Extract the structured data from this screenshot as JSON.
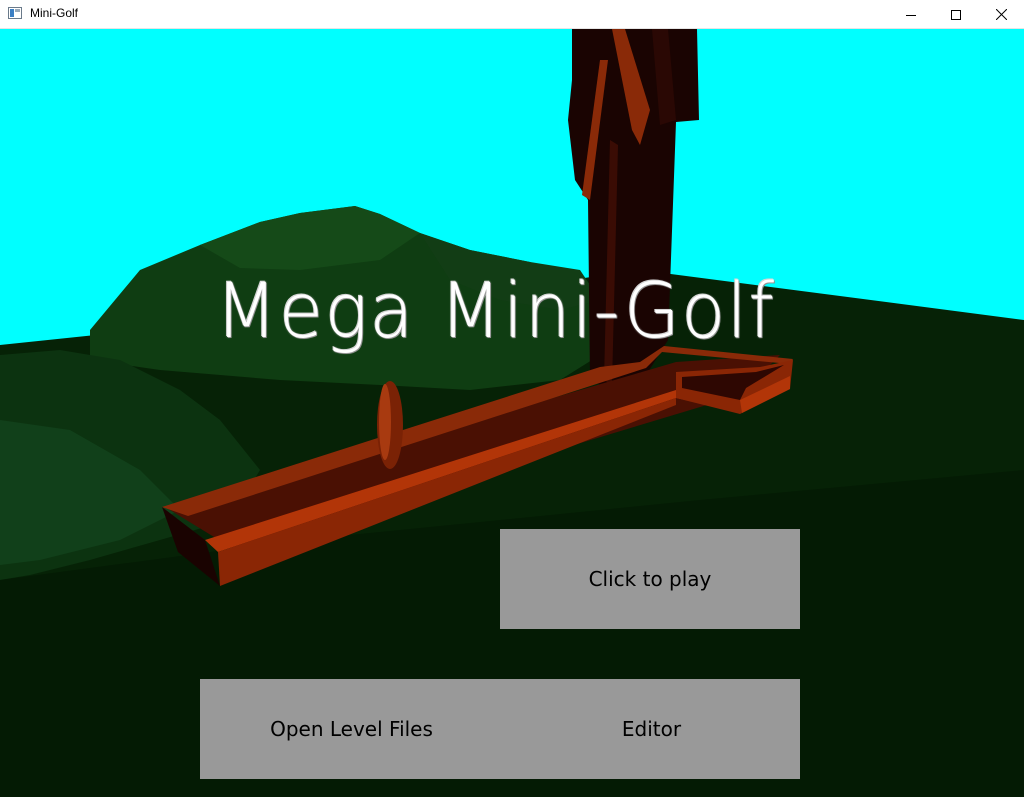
{
  "window": {
    "title": "Mini-Golf",
    "icon": "app-window-icon",
    "controls": [
      "minimize-icon",
      "maximize-icon",
      "close-icon"
    ]
  },
  "game": {
    "title": "Mega Mini-Golf"
  },
  "menu": {
    "play_label": "Click to play",
    "open_label": "Open Level Files",
    "editor_label": "Editor"
  },
  "colors": {
    "sky": "#00ffff",
    "ground": "#062206",
    "hills": "#0f3d12",
    "course_rail": "#9a2a05",
    "course_floor": "#4a1003",
    "tree": "#1a0402",
    "button": "#999999",
    "title_text": "#ffffff"
  }
}
